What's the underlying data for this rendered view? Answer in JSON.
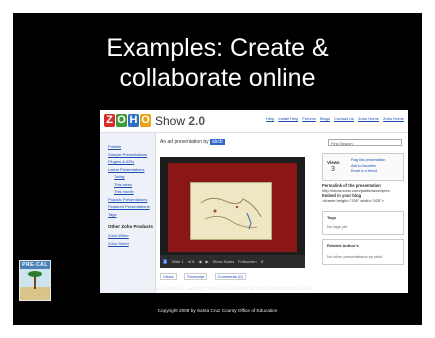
{
  "slide": {
    "title_line1": "Examples: Create &",
    "title_line2": "collaborate online",
    "citation": "Pre-Cal 40S Solution Manual, Jan 2007. Retrieved on 5/8/07 at http://pc40sf06.pbwiki.com/",
    "copyright": "Copyright 2008 by Santa Cruz County Office of Education",
    "logo_text": "PRE-CAL",
    "colors": {
      "background": "#000000",
      "text": "#ffffff"
    }
  },
  "screenshot": {
    "logo": {
      "letters": [
        "Z",
        "O",
        "H",
        "O"
      ],
      "product": "Show",
      "version": "2.0"
    },
    "top_links": [
      "Help",
      "Install Help",
      "Forums",
      "Blogs",
      "Contact Us",
      "Zoho Home",
      "Zoho Home"
    ],
    "sidebar": {
      "items": [
        "Publish",
        "Sample Presentations",
        "Plugins & APIs",
        "Latest Presentations",
        "Today",
        "This week",
        "This month",
        "Popular Presentations",
        "Featured Presentations",
        "Tags"
      ],
      "section_header": "Other Zoho Products",
      "more_items": [
        "Zoho Writer",
        "Zoho Sheet"
      ]
    },
    "main": {
      "title_prefix": "An ad presentation by",
      "owner": "sbcb",
      "controls": [
        "Slide 1",
        "of 5",
        "Show Notes",
        "Fullscreen"
      ],
      "tabs": [
        "Views",
        "Transcript",
        "Comments (0)"
      ]
    },
    "right": {
      "search_placeholder": "Find Search",
      "views_label": "Views",
      "views_count": "3",
      "options": [
        "Flag this presentation",
        "Add to favorites",
        "Email to a friend"
      ],
      "permalink_label": "Permalink of the presentation",
      "permalink_url": "http://show.zoho.com/public/sbcb/pres",
      "embed_label": "Embed in your blog",
      "embed_code": "<iframe height=\"335\" width=\"425\">",
      "tags_label": "Tags",
      "tags_value": "No tags yet",
      "related_header": "Related   Author's",
      "related_body": "No other presentations by sbcb"
    }
  }
}
